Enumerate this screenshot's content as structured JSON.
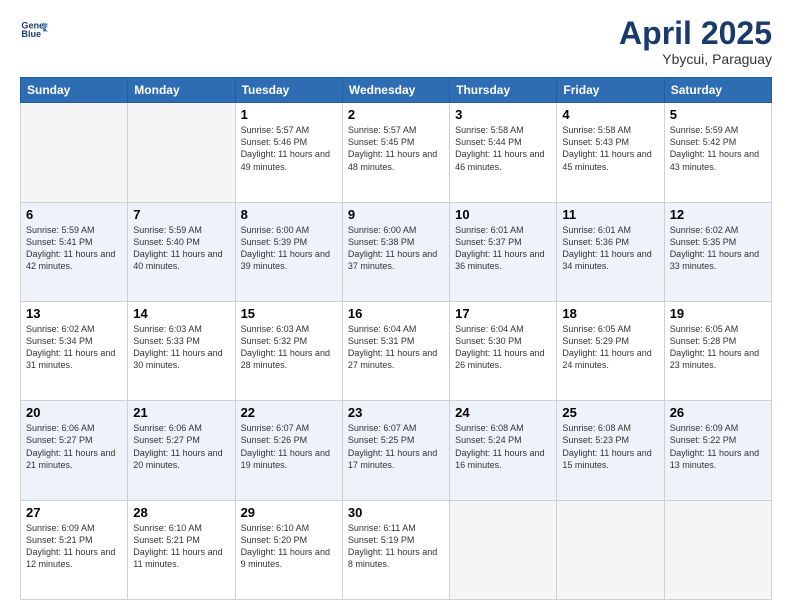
{
  "header": {
    "logo_line1": "General",
    "logo_line2": "Blue",
    "month_title": "April 2025",
    "subtitle": "Ybycui, Paraguay"
  },
  "days_of_week": [
    "Sunday",
    "Monday",
    "Tuesday",
    "Wednesday",
    "Thursday",
    "Friday",
    "Saturday"
  ],
  "weeks": [
    [
      {
        "day": "",
        "info": ""
      },
      {
        "day": "",
        "info": ""
      },
      {
        "day": "1",
        "info": "Sunrise: 5:57 AM\nSunset: 5:46 PM\nDaylight: 11 hours and 49 minutes."
      },
      {
        "day": "2",
        "info": "Sunrise: 5:57 AM\nSunset: 5:45 PM\nDaylight: 11 hours and 48 minutes."
      },
      {
        "day": "3",
        "info": "Sunrise: 5:58 AM\nSunset: 5:44 PM\nDaylight: 11 hours and 46 minutes."
      },
      {
        "day": "4",
        "info": "Sunrise: 5:58 AM\nSunset: 5:43 PM\nDaylight: 11 hours and 45 minutes."
      },
      {
        "day": "5",
        "info": "Sunrise: 5:59 AM\nSunset: 5:42 PM\nDaylight: 11 hours and 43 minutes."
      }
    ],
    [
      {
        "day": "6",
        "info": "Sunrise: 5:59 AM\nSunset: 5:41 PM\nDaylight: 11 hours and 42 minutes."
      },
      {
        "day": "7",
        "info": "Sunrise: 5:59 AM\nSunset: 5:40 PM\nDaylight: 11 hours and 40 minutes."
      },
      {
        "day": "8",
        "info": "Sunrise: 6:00 AM\nSunset: 5:39 PM\nDaylight: 11 hours and 39 minutes."
      },
      {
        "day": "9",
        "info": "Sunrise: 6:00 AM\nSunset: 5:38 PM\nDaylight: 11 hours and 37 minutes."
      },
      {
        "day": "10",
        "info": "Sunrise: 6:01 AM\nSunset: 5:37 PM\nDaylight: 11 hours and 36 minutes."
      },
      {
        "day": "11",
        "info": "Sunrise: 6:01 AM\nSunset: 5:36 PM\nDaylight: 11 hours and 34 minutes."
      },
      {
        "day": "12",
        "info": "Sunrise: 6:02 AM\nSunset: 5:35 PM\nDaylight: 11 hours and 33 minutes."
      }
    ],
    [
      {
        "day": "13",
        "info": "Sunrise: 6:02 AM\nSunset: 5:34 PM\nDaylight: 11 hours and 31 minutes."
      },
      {
        "day": "14",
        "info": "Sunrise: 6:03 AM\nSunset: 5:33 PM\nDaylight: 11 hours and 30 minutes."
      },
      {
        "day": "15",
        "info": "Sunrise: 6:03 AM\nSunset: 5:32 PM\nDaylight: 11 hours and 28 minutes."
      },
      {
        "day": "16",
        "info": "Sunrise: 6:04 AM\nSunset: 5:31 PM\nDaylight: 11 hours and 27 minutes."
      },
      {
        "day": "17",
        "info": "Sunrise: 6:04 AM\nSunset: 5:30 PM\nDaylight: 11 hours and 26 minutes."
      },
      {
        "day": "18",
        "info": "Sunrise: 6:05 AM\nSunset: 5:29 PM\nDaylight: 11 hours and 24 minutes."
      },
      {
        "day": "19",
        "info": "Sunrise: 6:05 AM\nSunset: 5:28 PM\nDaylight: 11 hours and 23 minutes."
      }
    ],
    [
      {
        "day": "20",
        "info": "Sunrise: 6:06 AM\nSunset: 5:27 PM\nDaylight: 11 hours and 21 minutes."
      },
      {
        "day": "21",
        "info": "Sunrise: 6:06 AM\nSunset: 5:27 PM\nDaylight: 11 hours and 20 minutes."
      },
      {
        "day": "22",
        "info": "Sunrise: 6:07 AM\nSunset: 5:26 PM\nDaylight: 11 hours and 19 minutes."
      },
      {
        "day": "23",
        "info": "Sunrise: 6:07 AM\nSunset: 5:25 PM\nDaylight: 11 hours and 17 minutes."
      },
      {
        "day": "24",
        "info": "Sunrise: 6:08 AM\nSunset: 5:24 PM\nDaylight: 11 hours and 16 minutes."
      },
      {
        "day": "25",
        "info": "Sunrise: 6:08 AM\nSunset: 5:23 PM\nDaylight: 11 hours and 15 minutes."
      },
      {
        "day": "26",
        "info": "Sunrise: 6:09 AM\nSunset: 5:22 PM\nDaylight: 11 hours and 13 minutes."
      }
    ],
    [
      {
        "day": "27",
        "info": "Sunrise: 6:09 AM\nSunset: 5:21 PM\nDaylight: 11 hours and 12 minutes."
      },
      {
        "day": "28",
        "info": "Sunrise: 6:10 AM\nSunset: 5:21 PM\nDaylight: 11 hours and 11 minutes."
      },
      {
        "day": "29",
        "info": "Sunrise: 6:10 AM\nSunset: 5:20 PM\nDaylight: 11 hours and 9 minutes."
      },
      {
        "day": "30",
        "info": "Sunrise: 6:11 AM\nSunset: 5:19 PM\nDaylight: 11 hours and 8 minutes."
      },
      {
        "day": "",
        "info": ""
      },
      {
        "day": "",
        "info": ""
      },
      {
        "day": "",
        "info": ""
      }
    ]
  ]
}
